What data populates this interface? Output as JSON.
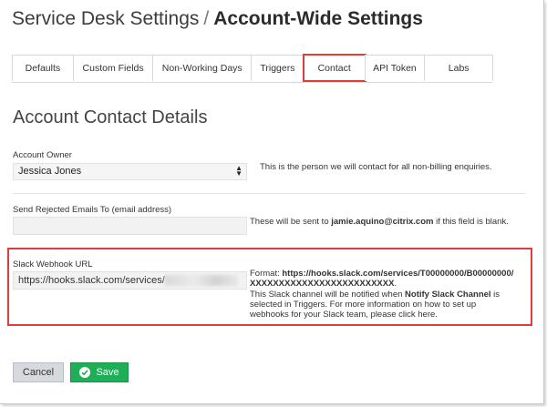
{
  "header": {
    "crumb": "Service Desk Settings",
    "separator": "/",
    "title": "Account-Wide Settings"
  },
  "tabs": [
    {
      "label": "Defaults"
    },
    {
      "label": "Custom Fields"
    },
    {
      "label": "Non-Working Days"
    },
    {
      "label": "Triggers"
    },
    {
      "label": "Contact",
      "active": true
    },
    {
      "label": "API Token"
    },
    {
      "label": "Labs"
    }
  ],
  "section": {
    "title": "Account Contact Details"
  },
  "owner": {
    "label": "Account Owner",
    "value": "Jessica Jones",
    "help": "This is the person we will contact for all non-billing enquiries."
  },
  "rejected": {
    "label": "Send Rejected Emails To (email address)",
    "value": "",
    "help_prefix": "These will be sent to ",
    "help_email": "jamie.aquino@citrix.com",
    "help_suffix": " if this field is blank."
  },
  "slack": {
    "label": "Slack Webhook URL",
    "value": "https://hooks.slack.com/services/",
    "format_prefix": "Format: ",
    "format_value": "https://hooks.slack.com/services/T00000000/B00000000/XXXXXXXXXXXXXXXXXXXXXXXXX",
    "format_end": ".",
    "desc_prefix": "This Slack channel will be notified when ",
    "desc_bold": "Notify Slack Channel",
    "desc_suffix": " is selected in Triggers. For more information on how to set up webhooks for your Slack team, please click here."
  },
  "actions": {
    "cancel_label": "Cancel",
    "save_label": "Save"
  },
  "colors": {
    "highlight": "#e23b3b",
    "save": "#1fae58",
    "cancel": "#d6d9de"
  }
}
